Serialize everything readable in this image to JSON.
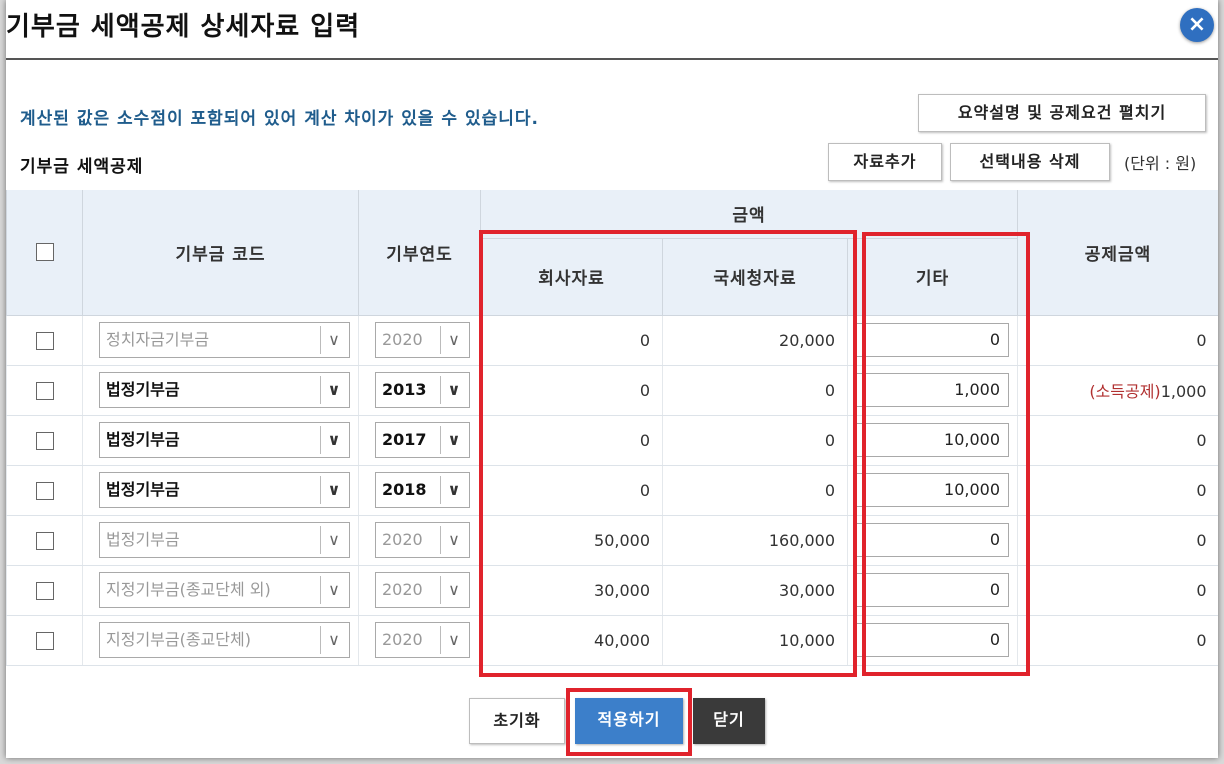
{
  "dialog": {
    "title": "기부금 세액공제 상세자료 입력",
    "close_label": "×",
    "notice": "계산된 값은 소수점이 포함되어 있어 계산 차이가 있을 수 있습니다.",
    "summary_button": "요약설명 및 공제요건 펼치기",
    "section_title": "기부금 세액공제",
    "add_button": "자료추가",
    "delete_button": "선택내용 삭제",
    "unit_label": "(단위 : 원)"
  },
  "table": {
    "headers": {
      "code": "기부금 코드",
      "year": "기부연도",
      "amount": "금액",
      "company": "회사자료",
      "nts": "국세청자료",
      "other": "기타",
      "deduction": "공제금액"
    },
    "rows": [
      {
        "code": "정치자금기부금",
        "year": "2020",
        "enabled": false,
        "company": "0",
        "nts": "20,000",
        "other": "0",
        "deduction_prefix": "",
        "deduction": "0"
      },
      {
        "code": "법정기부금",
        "year": "2013",
        "enabled": true,
        "company": "0",
        "nts": "0",
        "other": "1,000",
        "deduction_prefix": "(소득공제)",
        "deduction": "1,000"
      },
      {
        "code": "법정기부금",
        "year": "2017",
        "enabled": true,
        "company": "0",
        "nts": "0",
        "other": "10,000",
        "deduction_prefix": "",
        "deduction": "0"
      },
      {
        "code": "법정기부금",
        "year": "2018",
        "enabled": true,
        "company": "0",
        "nts": "0",
        "other": "10,000",
        "deduction_prefix": "",
        "deduction": "0"
      },
      {
        "code": "법정기부금",
        "year": "2020",
        "enabled": false,
        "company": "50,000",
        "nts": "160,000",
        "other": "0",
        "deduction_prefix": "",
        "deduction": "0"
      },
      {
        "code": "지정기부금(종교단체 외)",
        "year": "2020",
        "enabled": false,
        "company": "30,000",
        "nts": "30,000",
        "other": "0",
        "deduction_prefix": "",
        "deduction": "0"
      },
      {
        "code": "지정기부금(종교단체)",
        "year": "2020",
        "enabled": false,
        "company": "40,000",
        "nts": "10,000",
        "other": "0",
        "deduction_prefix": "",
        "deduction": "0"
      }
    ]
  },
  "footer": {
    "reset_button": "초기화",
    "apply_button": "적용하기",
    "close_button": "닫기"
  },
  "colors": {
    "highlight": "#e0232c",
    "apply": "#3c7fca",
    "close": "#3a3a3a",
    "notice": "#1f5c8c",
    "header_bg": "#e9f0f8"
  }
}
